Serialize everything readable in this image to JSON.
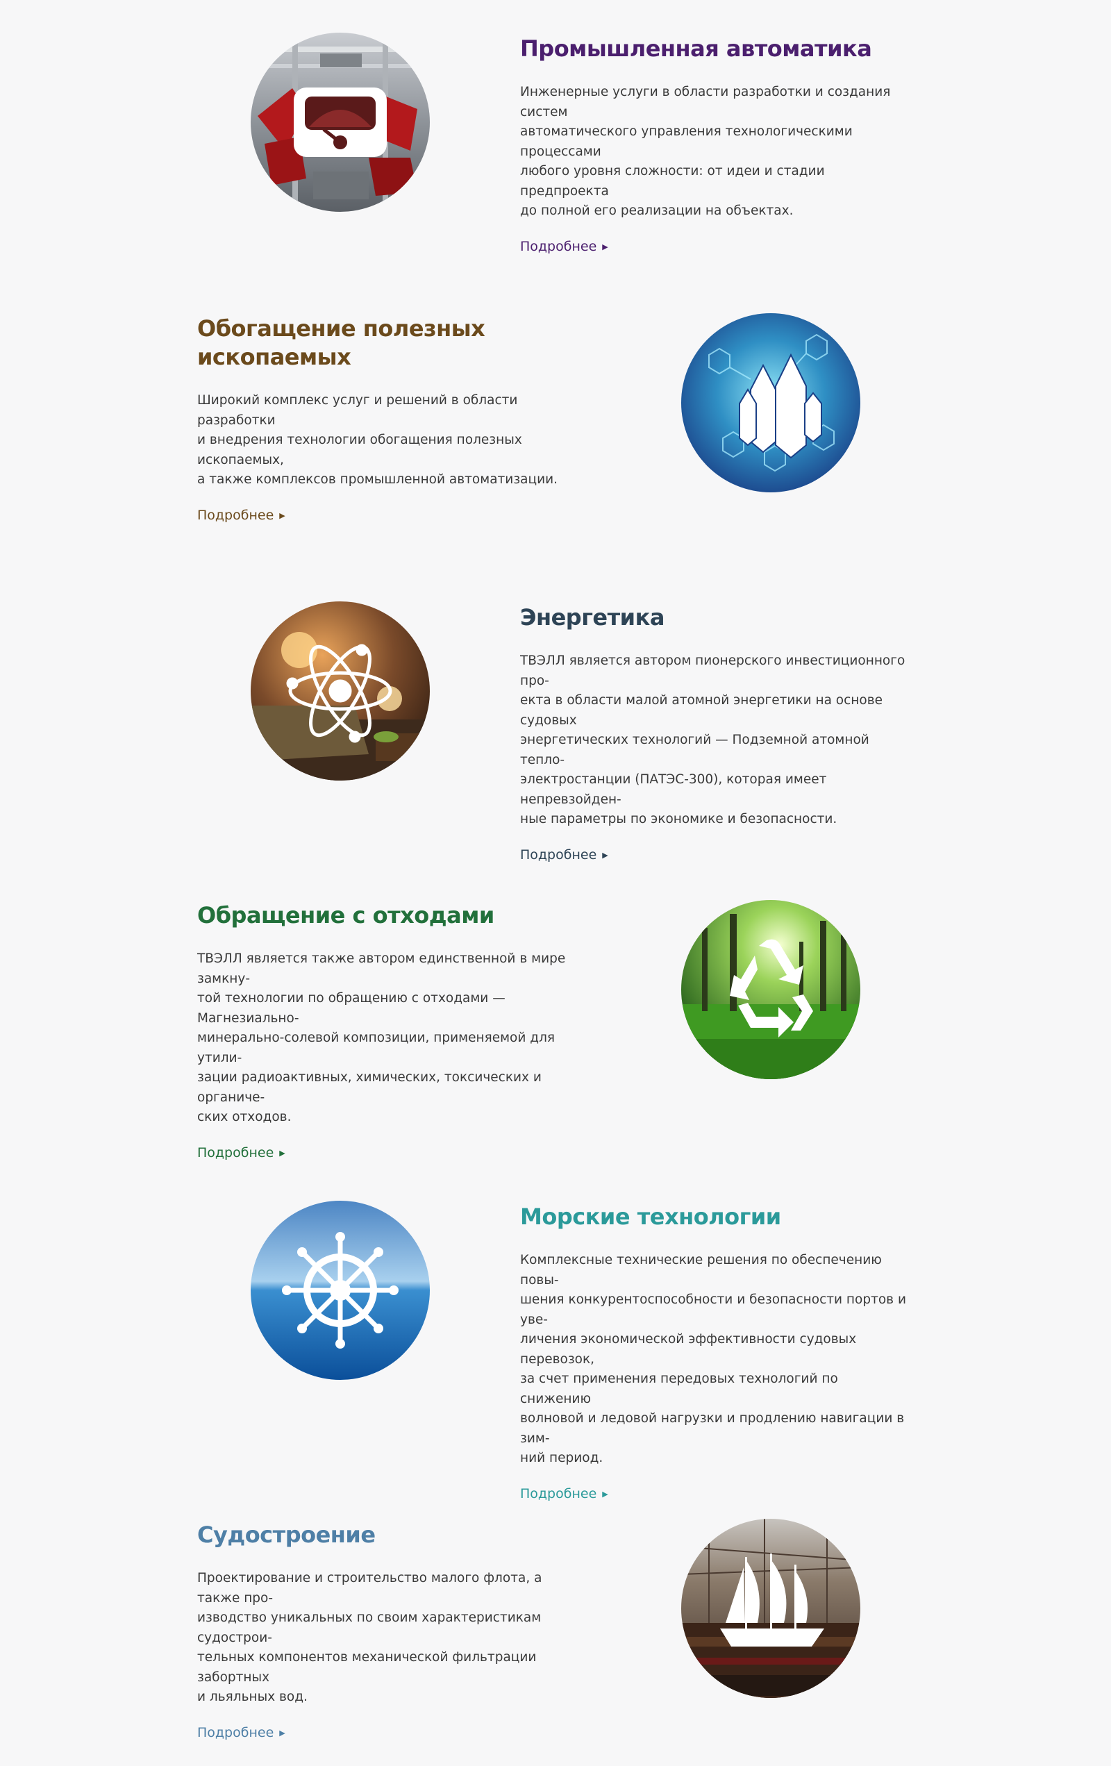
{
  "more_label": "Подробнее",
  "colors": {
    "automation": "#4b1f6e",
    "minerals": "#6b4a1c",
    "energy": "#2e4456",
    "waste": "#22703b",
    "marine": "#2b9a9a",
    "shipbuilding": "#4e7fa6"
  },
  "sections": [
    {
      "key": "automation",
      "title": "Промышленная автоматика",
      "lines": [
        "Инженерные услуги в области разработки и создания систем",
        "автоматического управления технологическими процессами",
        "любого уровня сложности: от идеи и стадии предпроекта",
        "до полной его реализации на объектах."
      ],
      "icon": "gauge-icon"
    },
    {
      "key": "minerals",
      "title_lines": [
        "Обогащение полезных",
        "ископаемых"
      ],
      "lines": [
        "Широкий комплекс услуг и решений в области разработки",
        "и внедрения технологии обогащения полезных ископаемых,",
        "а также комплексов промышленной автоматизации."
      ],
      "icon": "crystal-icon"
    },
    {
      "key": "energy",
      "title": "Энергетика",
      "lines": [
        "ТВЭЛЛ является автором пионерского инвестиционного про-",
        "екта в области малой атомной энергетики на основе судовых",
        "энергетических технологий — Подземной атомной тепло-",
        "электростанции (ПАТЭС-300), которая имеет непревзойден-",
        "ные параметры по экономике и безопасности."
      ],
      "icon": "atom-icon"
    },
    {
      "key": "waste",
      "title": "Обращение с отходами",
      "lines": [
        "ТВЭЛЛ является также автором единственной в мире замкну-",
        "той технологии по обращению с отходами — Магнезиально-",
        "минерально-солевой композиции, применяемой для утили-",
        "зации радиоактивных, химических, токсических и органиче-",
        "ских отходов."
      ],
      "icon": "recycle-icon"
    },
    {
      "key": "marine",
      "title": "Морские технологии",
      "lines": [
        "Комплексные технические решения по обеспечению повы-",
        "шения конкурентоспособности и безопасности портов и уве-",
        "личения экономической эффективности судовых перевозок,",
        "за счет применения передовых технологий по снижению",
        "волновой и ледовой нагрузки и продлению навигации в зим-",
        "ний период."
      ],
      "icon": "ship-wheel-icon"
    },
    {
      "key": "shipbuilding",
      "title": "Судостроение",
      "lines": [
        "Проектирование и строительство малого флота, а также про-",
        "изводство уникальных по своим характеристикам судострои-",
        "тельных компонентов механической фильтрации забортных",
        "и льяльных вод."
      ],
      "icon": "sailing-ship-icon"
    }
  ]
}
